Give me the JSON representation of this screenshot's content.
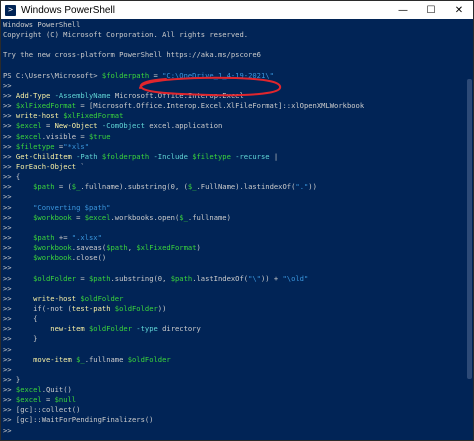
{
  "window": {
    "title": "Windows PowerShell",
    "icon": "powershell-icon",
    "controls": {
      "minimize": "—",
      "maximize": "☐",
      "close": "✕"
    }
  },
  "console": {
    "lines": [
      [
        [
          "Windows PowerShell",
          "g"
        ]
      ],
      [
        [
          "Copyright (C) Microsoft Corporation. All rights reserved.",
          "g"
        ]
      ],
      [
        [
          "",
          "g"
        ]
      ],
      [
        [
          "Try the new cross-platform PowerShell https://aka.ms/pscore6",
          "g"
        ]
      ],
      [
        [
          "",
          "g"
        ]
      ],
      [
        [
          "PS C:\\Users\\Microsoft> ",
          "g"
        ],
        [
          "$folderpath",
          "v"
        ],
        [
          " = ",
          "g"
        ],
        [
          "\"C:\\OneDrive_1_4-19-2021\\\"",
          "s"
        ]
      ],
      [
        [
          ">> ",
          "g"
        ]
      ],
      [
        [
          ">> ",
          "g"
        ],
        [
          "Add-Type",
          "y"
        ],
        [
          " -AssemblyName ",
          "par"
        ],
        [
          "Microsoft.Office.Interop.Excel",
          "g"
        ]
      ],
      [
        [
          ">> ",
          "g"
        ],
        [
          "$xlFixedFormat",
          "v"
        ],
        [
          " = ",
          "g"
        ],
        [
          "[Microsoft.Office.Interop.Excel.XlFileFormat]",
          "g"
        ],
        [
          "::xlOpenXMLWorkbook",
          "g"
        ]
      ],
      [
        [
          ">> ",
          "g"
        ],
        [
          "write-host",
          "y"
        ],
        [
          " $xlFixedFormat",
          "v"
        ]
      ],
      [
        [
          ">> ",
          "g"
        ],
        [
          "$excel",
          "v"
        ],
        [
          " = ",
          "g"
        ],
        [
          "New-Object",
          "y"
        ],
        [
          " -ComObject ",
          "par"
        ],
        [
          "excel.application",
          "g"
        ]
      ],
      [
        [
          ">> ",
          "g"
        ],
        [
          "$excel",
          "v"
        ],
        [
          ".visible = ",
          "g"
        ],
        [
          "$true",
          "v"
        ]
      ],
      [
        [
          ">> ",
          "g"
        ],
        [
          "$filetype",
          "v"
        ],
        [
          " =",
          "g"
        ],
        [
          "\"*xls\"",
          "s"
        ]
      ],
      [
        [
          ">> ",
          "g"
        ],
        [
          "Get-ChildItem",
          "y"
        ],
        [
          " -Path ",
          "par"
        ],
        [
          "$folderpath",
          "v"
        ],
        [
          " -Include ",
          "par"
        ],
        [
          "$filetype",
          "v"
        ],
        [
          " -recurse",
          "par"
        ],
        [
          " |",
          "g"
        ]
      ],
      [
        [
          ">> ",
          "g"
        ],
        [
          "ForEach-Object",
          "y"
        ],
        [
          " `",
          "g"
        ]
      ],
      [
        [
          ">> ",
          "g"
        ],
        [
          "{",
          "g"
        ]
      ],
      [
        [
          ">>     ",
          "g"
        ],
        [
          "$path",
          "v"
        ],
        [
          " = (",
          "g"
        ],
        [
          "$_",
          "v"
        ],
        [
          ".fullname).substring(0, (",
          "g"
        ],
        [
          "$_",
          "v"
        ],
        [
          ".FullName).lastindexOf(",
          "g"
        ],
        [
          "\".\"",
          "s"
        ],
        [
          "))",
          "g"
        ]
      ],
      [
        [
          ">> ",
          "g"
        ]
      ],
      [
        [
          ">>     ",
          "g"
        ],
        [
          "\"Converting $path\"",
          "s"
        ]
      ],
      [
        [
          ">>     ",
          "g"
        ],
        [
          "$workbook",
          "v"
        ],
        [
          " = ",
          "g"
        ],
        [
          "$excel",
          "v"
        ],
        [
          ".workbooks.open(",
          "g"
        ],
        [
          "$_",
          "v"
        ],
        [
          ".fullname)",
          "g"
        ]
      ],
      [
        [
          ">> ",
          "g"
        ]
      ],
      [
        [
          ">>     ",
          "g"
        ],
        [
          "$path",
          "v"
        ],
        [
          " += ",
          "g"
        ],
        [
          "\".xlsx\"",
          "s"
        ]
      ],
      [
        [
          ">>     ",
          "g"
        ],
        [
          "$workbook",
          "v"
        ],
        [
          ".saveas(",
          "g"
        ],
        [
          "$path",
          "v"
        ],
        [
          ", ",
          "g"
        ],
        [
          "$xlFixedFormat",
          "v"
        ],
        [
          ")",
          "g"
        ]
      ],
      [
        [
          ">>     ",
          "g"
        ],
        [
          "$workbook",
          "v"
        ],
        [
          ".close()",
          "g"
        ]
      ],
      [
        [
          ">> ",
          "g"
        ]
      ],
      [
        [
          ">>     ",
          "g"
        ],
        [
          "$oldFolder",
          "v"
        ],
        [
          " = ",
          "g"
        ],
        [
          "$path",
          "v"
        ],
        [
          ".substring(0, ",
          "g"
        ],
        [
          "$path",
          "v"
        ],
        [
          ".lastIndexOf(",
          "g"
        ],
        [
          "\"\\\"",
          "s"
        ],
        [
          ")) + ",
          "g"
        ],
        [
          "\"\\old\"",
          "s"
        ]
      ],
      [
        [
          ">> ",
          "g"
        ]
      ],
      [
        [
          ">>     ",
          "g"
        ],
        [
          "write-host",
          "y"
        ],
        [
          " $oldFolder",
          "v"
        ]
      ],
      [
        [
          ">>     ",
          "g"
        ],
        [
          "if",
          "g"
        ],
        [
          "(-not (",
          "g"
        ],
        [
          "test-path",
          "y"
        ],
        [
          " $oldFolder",
          "v"
        ],
        [
          "))",
          "g"
        ]
      ],
      [
        [
          ">>     ",
          "g"
        ],
        [
          "{",
          "g"
        ]
      ],
      [
        [
          ">>         ",
          "g"
        ],
        [
          "new-item",
          "y"
        ],
        [
          " $oldFolder",
          "v"
        ],
        [
          " -type ",
          "par"
        ],
        [
          "directory",
          "g"
        ]
      ],
      [
        [
          ">>     ",
          "g"
        ],
        [
          "}",
          "g"
        ]
      ],
      [
        [
          ">> ",
          "g"
        ]
      ],
      [
        [
          ">>     ",
          "g"
        ],
        [
          "move-item",
          "y"
        ],
        [
          " $_",
          "v"
        ],
        [
          ".fullname ",
          "g"
        ],
        [
          "$oldFolder",
          "v"
        ]
      ],
      [
        [
          ">> ",
          "g"
        ]
      ],
      [
        [
          ">> ",
          "g"
        ],
        [
          "}",
          "g"
        ]
      ],
      [
        [
          ">> ",
          "g"
        ],
        [
          "$excel",
          "v"
        ],
        [
          ".Quit()",
          "g"
        ]
      ],
      [
        [
          ">> ",
          "g"
        ],
        [
          "$excel",
          "v"
        ],
        [
          " = ",
          "g"
        ],
        [
          "$null",
          "v"
        ]
      ],
      [
        [
          ">> ",
          "g"
        ],
        [
          "[gc]",
          "g"
        ],
        [
          "::collect()",
          "g"
        ]
      ],
      [
        [
          ">> ",
          "g"
        ],
        [
          "[gc]",
          "g"
        ],
        [
          "::WaitForPendingFinalizers()",
          "g"
        ]
      ],
      [
        [
          ">> ",
          "g"
        ]
      ]
    ]
  },
  "colors": {
    "background": "#012456",
    "text": "#cccccc",
    "cmdlet": "#f9f1a5",
    "variable": "#3bd63b",
    "string": "#3a96dd",
    "parameter": "#61d6d6",
    "annotation": "#e0262d"
  }
}
